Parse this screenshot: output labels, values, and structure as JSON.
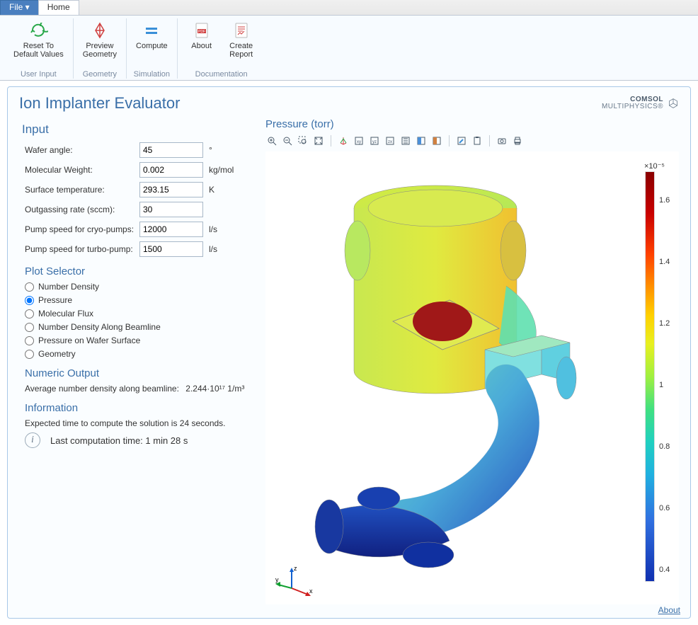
{
  "tabs": {
    "file": "File ▾",
    "home": "Home"
  },
  "ribbon": {
    "groups": [
      {
        "label": "User Input",
        "buttons": [
          {
            "id": "reset",
            "label": "Reset To\nDefault Values"
          }
        ]
      },
      {
        "label": "Geometry",
        "buttons": [
          {
            "id": "preview",
            "label": "Preview\nGeometry"
          }
        ]
      },
      {
        "label": "Simulation",
        "buttons": [
          {
            "id": "compute",
            "label": "Compute"
          }
        ]
      },
      {
        "label": "Documentation",
        "buttons": [
          {
            "id": "about",
            "label": "About"
          },
          {
            "id": "report",
            "label": "Create\nReport"
          }
        ]
      }
    ]
  },
  "app_title": "Ion Implanter Evaluator",
  "brand_top": "COMSOL",
  "brand_bottom": "MULTIPHYSICS®",
  "sections": {
    "input": "Input",
    "plot_selector": "Plot Selector",
    "numeric_output": "Numeric Output",
    "information": "Information"
  },
  "fields": [
    {
      "label": "Wafer angle:",
      "value": "45",
      "unit": "°"
    },
    {
      "label": "Molecular Weight:",
      "value": "0.002",
      "unit": "kg/mol"
    },
    {
      "label": "Surface temperature:",
      "value": "293.15",
      "unit": "K"
    },
    {
      "label": "Outgassing rate (sccm):",
      "value": "30",
      "unit": ""
    },
    {
      "label": "Pump speed for cryo-pumps:",
      "value": "12000",
      "unit": "l/s"
    },
    {
      "label": "Pump speed for turbo-pump:",
      "value": "1500",
      "unit": "l/s"
    }
  ],
  "plot_options": [
    {
      "label": "Number Density",
      "selected": false
    },
    {
      "label": "Pressure",
      "selected": true
    },
    {
      "label": "Molecular Flux",
      "selected": false
    },
    {
      "label": "Number Density Along Beamline",
      "selected": false
    },
    {
      "label": "Pressure on Wafer Surface",
      "selected": false
    },
    {
      "label": "Geometry",
      "selected": false
    }
  ],
  "numeric_output": {
    "label": "Average number density along beamline:",
    "value": "2.244·10¹⁷ 1/m³"
  },
  "information": {
    "expected": "Expected time to compute the solution is 24 seconds.",
    "last": "Last computation time: 1 min 28 s"
  },
  "plot": {
    "title": "Pressure (torr)",
    "colorbar_exp": "×10⁻⁵",
    "ticks": [
      {
        "pos": 7,
        "label": "1.6"
      },
      {
        "pos": 22,
        "label": "1.4"
      },
      {
        "pos": 37,
        "label": "1.2"
      },
      {
        "pos": 52,
        "label": "1"
      },
      {
        "pos": 67,
        "label": "0.8"
      },
      {
        "pos": 82,
        "label": "0.6"
      },
      {
        "pos": 97,
        "label": "0.4"
      }
    ],
    "axes": {
      "x": "x",
      "y": "y",
      "z": "z"
    }
  },
  "about_link": "About"
}
